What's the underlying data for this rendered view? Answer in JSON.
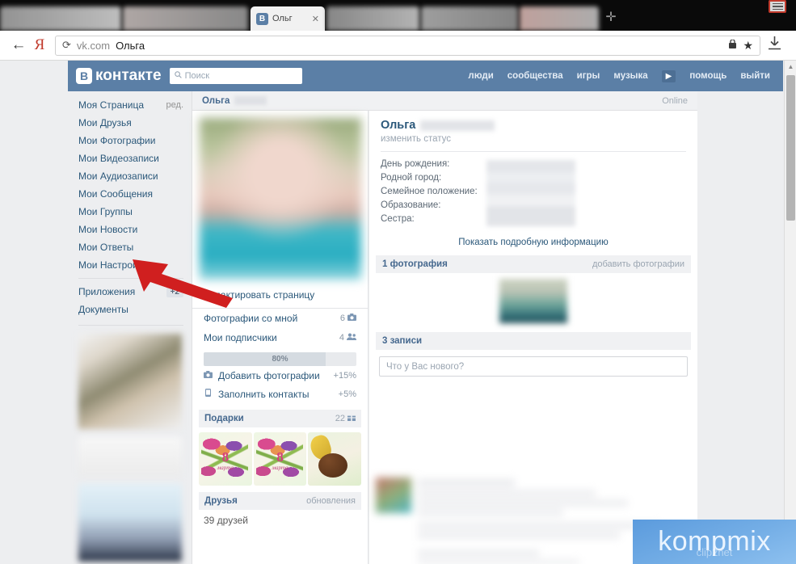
{
  "browser": {
    "tab": {
      "favicon_letter": "В",
      "title": "Ольг",
      "close_icon": "✕"
    },
    "new_tab_icon": "✛",
    "back_icon": "←",
    "brand_icon": "Я",
    "reload_icon": "⟳",
    "url_domain": "vk.com",
    "url_text": "Ольга",
    "lock_icon": "🔒",
    "star_icon": "★",
    "download_icon": "⤓",
    "window_menu_icon": "menu-icon"
  },
  "vk_header": {
    "logo_mark": "В",
    "logo_text": "контакте",
    "search_icon": "⌕",
    "search_placeholder": "Поиск",
    "nav": [
      {
        "label": "люди"
      },
      {
        "label": "сообщества"
      },
      {
        "label": "игры"
      },
      {
        "label": "музыка"
      }
    ],
    "more_icon": "▶",
    "help_label": "помощь",
    "logout_label": "выйти"
  },
  "sidebar": {
    "items": [
      {
        "label": "Моя Страница",
        "extra": "ред."
      },
      {
        "label": "Мои Друзья",
        "extra": ""
      },
      {
        "label": "Мои Фотографии",
        "extra": ""
      },
      {
        "label": "Мои Видеозаписи",
        "extra": ""
      },
      {
        "label": "Мои Аудиозаписи",
        "extra": ""
      },
      {
        "label": "Мои Сообщения",
        "extra": ""
      },
      {
        "label": "Мои Группы",
        "extra": ""
      },
      {
        "label": "Мои Новости",
        "extra": ""
      },
      {
        "label": "Мои Ответы",
        "extra": ""
      },
      {
        "label": "Мои Настройки",
        "extra": ""
      }
    ],
    "apps": {
      "label": "Приложения",
      "badge": "+2"
    },
    "docs": {
      "label": "Документы"
    }
  },
  "profile_strip": {
    "name": "Ольга",
    "online_label": "Online"
  },
  "profile": {
    "name": "Ольга",
    "status_link": "изменить статус",
    "info_rows": [
      {
        "label": "День рождения:"
      },
      {
        "label": "Родной город:"
      },
      {
        "label": "Семейное положение:"
      },
      {
        "label": "Образование:"
      },
      {
        "label": "Сестра:"
      }
    ],
    "show_more": "Показать подробную информацию"
  },
  "left_column": {
    "edit_page": "Редактировать страницу",
    "rows": [
      {
        "label": "Фотографии со мной",
        "count": "6",
        "icon": "camera-icon"
      },
      {
        "label": "Мои подписчики",
        "count": "4",
        "icon": "people-icon"
      }
    ],
    "progress": {
      "percent_label": "80%",
      "percent": 80
    },
    "tasks": [
      {
        "icon": "camera-icon",
        "label": "Добавить фотографии",
        "bonus": "+15%"
      },
      {
        "icon": "phone-icon",
        "label": "Заполнить контакты",
        "bonus": "+5%"
      }
    ],
    "gifts": {
      "title": "Подарки",
      "count": "22",
      "icon": "gift-grid-icon",
      "items": [
        {
          "kind": "tulip",
          "number": "8",
          "word": "марта"
        },
        {
          "kind": "tulip",
          "number": "8",
          "word": "марта"
        },
        {
          "kind": "choco",
          "number": "",
          "word": ""
        }
      ]
    },
    "friends": {
      "title": "Друзья",
      "link": "обновления",
      "count_label": "39 друзей"
    }
  },
  "right_column": {
    "photos": {
      "title": "1 фотография",
      "link": "добавить фотографии"
    },
    "posts": {
      "title": "3 записи",
      "placeholder": "Что у Вас нового?"
    }
  },
  "watermark": {
    "text": "kompmix",
    "sub": "clip2net"
  },
  "colors": {
    "vk_blue": "#5b7fa6",
    "link_blue": "#2b587a",
    "page_bg": "#edeef0",
    "accent_red": "#d01f1f",
    "watermark_blue": "#74aee6"
  }
}
